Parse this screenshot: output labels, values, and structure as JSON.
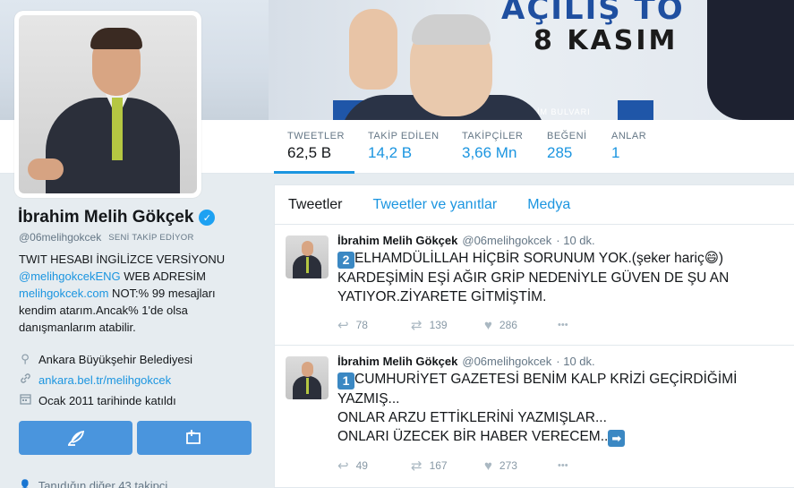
{
  "banner": {
    "line1": "AÇILIŞ TÖ",
    "line2": "8 KASIM",
    "street": "SELİM BULVARI"
  },
  "stats": [
    {
      "label": "TWEETLER",
      "value": "62,5 B",
      "active": true
    },
    {
      "label": "TAKİP EDİLEN",
      "value": "14,2 B"
    },
    {
      "label": "TAKİPÇİLER",
      "value": "3,66 Mn"
    },
    {
      "label": "BEĞENİ",
      "value": "285"
    },
    {
      "label": "ANLAR",
      "value": "1"
    }
  ],
  "profile": {
    "name": "İbrahim Melih Gökçek",
    "handle": "@06melihgokcek",
    "follows_you": "SENİ TAKİP EDİYOR",
    "bio_line1": "TWIT HESABI İNGİLİZCE VERSİYONU",
    "bio_link1": "@melihgokcekENG",
    "bio_after_link1": " WEB ADRESİM",
    "bio_link2": "melihgokcek.com",
    "bio_after_link2": " NOT:% 99 mesajları kendim atarım.Ancak% 1'de olsa danışmanlarım atabilir.",
    "location": "Ankara Büyükşehir Belediyesi",
    "website": "ankara.bel.tr/melihgokcek",
    "joined": "Ocak 2011 tarihinde katıldı",
    "known_followers": "Tanıdığın diğer 43 takipçi"
  },
  "tabs": [
    "Tweetler",
    "Tweetler ve yanıtlar",
    "Medya"
  ],
  "tweets": [
    {
      "name": "İbrahim Melih Gökçek",
      "handle": "@06melihgokcek",
      "time": "· 10 dk.",
      "badge": "2",
      "line1": "ELHAMDÜLİLLAH HİÇBİR SORUNUM YOK.(şeker hariç",
      "emoji": "😄",
      "line1_end": ")",
      "line2": "KARDEŞİMİN EŞİ AĞIR GRİP NEDENİYLE GÜVEN DE ŞU AN YATIYOR.ZİYARETE GİTMİŞTİM.",
      "replies": "78",
      "retweets": "139",
      "likes": "286"
    },
    {
      "name": "İbrahim Melih Gökçek",
      "handle": "@06melihgokcek",
      "time": "· 10 dk.",
      "badge": "1",
      "line1": "CUMHURİYET GAZETESİ  BENİM KALP KRİZİ GEÇİRDİĞİMİ YAZMIŞ...",
      "line2": "ONLAR ARZU ETTİKLERİNİ YAZMIŞLAR...",
      "line3": "ONLARI ÜZECEK BİR HABER VERECEM..",
      "arrow": "➡",
      "replies": "49",
      "retweets": "167",
      "likes": "273"
    }
  ],
  "icons": {
    "verified": "✓",
    "location": "⚲",
    "link": "🔗",
    "calendar": "▦",
    "reply": "↩",
    "retweet": "⇄",
    "like": "♥",
    "more": "•••",
    "dm": "✎",
    "compose": "⬚",
    "people": "👤"
  }
}
